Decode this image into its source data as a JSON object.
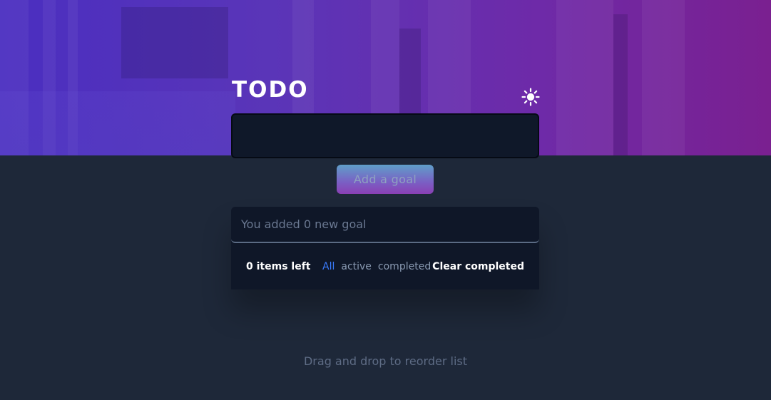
{
  "app": {
    "title": "TODO"
  },
  "header": {
    "theme_toggle_icon": "sun-icon"
  },
  "new_goal": {
    "value": "",
    "placeholder": "",
    "add_button_label": "Add a goal"
  },
  "list": {
    "items": [
      {
        "text": "You added 0 new goal"
      }
    ]
  },
  "footer": {
    "items_left": "0 items left",
    "filters": [
      {
        "label": "All",
        "selected": true
      },
      {
        "label": "active",
        "selected": false
      },
      {
        "label": "completed",
        "selected": false
      }
    ],
    "clear_label": "Clear completed"
  },
  "hint": "Drag and drop to reorder list",
  "colors": {
    "background": "#1e2839",
    "card": "#0f1728",
    "accent": "#3a7bfd",
    "hero_start": "#4a2ec0",
    "hero_end": "#7a2090"
  }
}
